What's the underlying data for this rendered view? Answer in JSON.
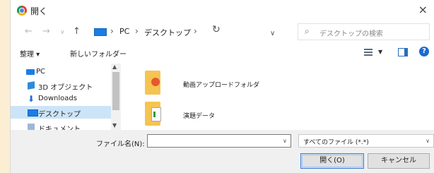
{
  "window": {
    "title": "開く",
    "close_glyph": "×"
  },
  "address": {
    "back_glyph": "←",
    "forward_glyph": "→",
    "recent_glyph": "∨",
    "up_glyph": "↑",
    "crumb_sep": "›",
    "crumbs": [
      "PC",
      "デスクトップ"
    ],
    "dropdown_glyph": "∨",
    "refresh_glyph": "↻",
    "search_placeholder": "デスクトップの検索",
    "search_glyph": "⌕"
  },
  "toolbar": {
    "organize_label": "整理 ▾",
    "new_folder_label": "新しいフォルダー",
    "view_dd_glyph": "▼",
    "help_glyph": "?"
  },
  "sidebar": {
    "items": [
      {
        "label": "PC",
        "icon": "pc-icon",
        "selected": false
      },
      {
        "label": "3D オブジェクト",
        "icon": "3d-objects-icon",
        "selected": false
      },
      {
        "label": "Downloads",
        "icon": "download-icon",
        "selected": false
      },
      {
        "label": "デスクトップ",
        "icon": "desktop-icon",
        "selected": true
      },
      {
        "label": "ドキュメント",
        "icon": "documents-icon",
        "selected": false
      }
    ],
    "scroll_up_glyph": "▲",
    "scroll_down_glyph": "▼"
  },
  "files": [
    {
      "name": "動画アップロードフォルダ",
      "icon": "media-folder-icon"
    },
    {
      "name": "演題データ",
      "icon": "data-folder-icon"
    }
  ],
  "footer": {
    "filename_label": "ファイル名(N):",
    "filename_value": "",
    "filename_dd_glyph": "∨",
    "filetype_value": "すべてのファイル (*.*)",
    "filetype_dd_glyph": "∨",
    "open_label": "開く(O)",
    "cancel_label": "キャンセル"
  },
  "colors": {
    "accent": "#1a7de6",
    "selection": "#cce4f7",
    "background": "#fbeed3"
  }
}
